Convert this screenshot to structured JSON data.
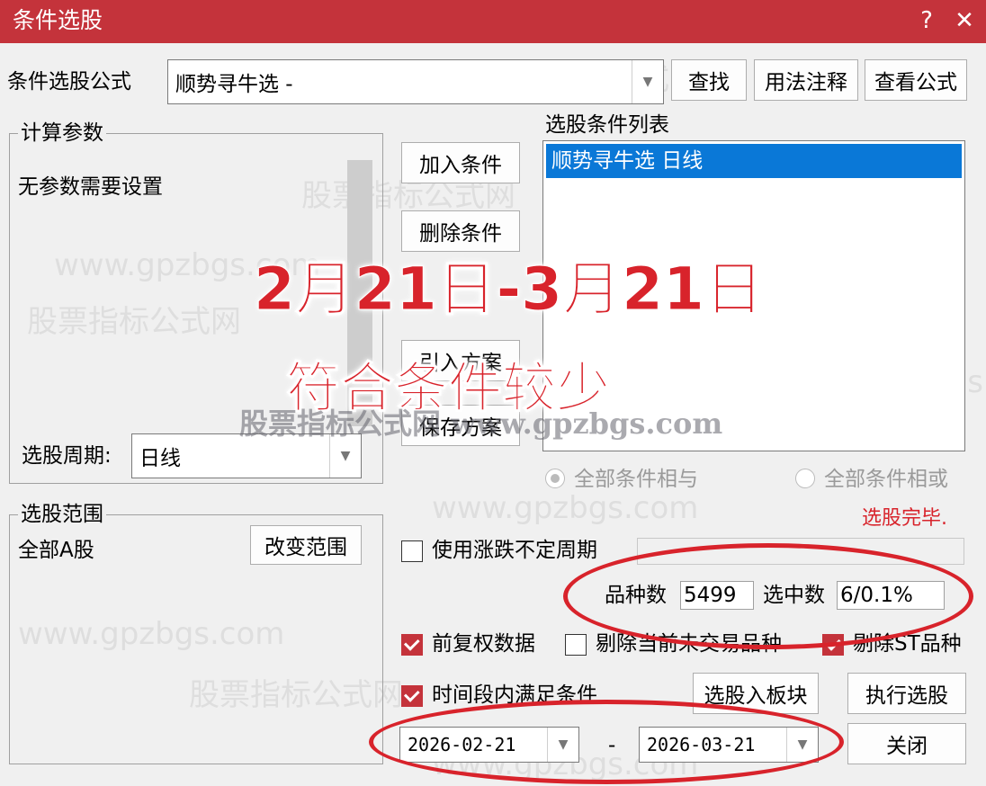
{
  "window": {
    "title": "条件选股",
    "help_symbol": "?",
    "close_symbol": "✕"
  },
  "formula": {
    "label": "条件选股公式",
    "value": "顺势寻牛选  -",
    "find_button": "查找",
    "usage_button": "用法注释",
    "view_button": "查看公式"
  },
  "params": {
    "legend": "计算参数",
    "message": "无参数需要设置",
    "period_label": "选股周期:",
    "period_value": "日线"
  },
  "buttons": {
    "add_condition": "加入条件",
    "delete_condition": "删除条件",
    "import_plan": "引入方案",
    "save_plan": "保存方案",
    "change_range": "改变范围",
    "to_block": "选股入板块",
    "execute": "执行选股",
    "close": "关闭"
  },
  "conditions": {
    "legend": "选股条件列表",
    "items": [
      "顺势寻牛选  日线"
    ],
    "radio_and": "全部条件相与",
    "radio_or": "全部条件相或",
    "status": "选股完毕."
  },
  "range": {
    "legend": "选股范围",
    "value": "全部A股"
  },
  "options": {
    "use_unfixed_period": "使用涨跌不定周期",
    "stock_count_label": "品种数",
    "stock_count_value": "5499",
    "selected_label": "选中数",
    "selected_value": "6/0.1%",
    "forward_adjusted": "前复权数据",
    "exclude_untraded": "剔除当前未交易品种",
    "exclude_st": "剔除ST品种",
    "period_satisfy": "时间段内满足条件"
  },
  "dates": {
    "start": "2026-02-21",
    "separator": "-",
    "end": "2026-03-21"
  },
  "overlay": {
    "date_range": "2月21日-3月21日",
    "note": "符合条件较少",
    "watermark_center": "股票指标公式网 www.gpzbgs.com"
  },
  "watermark": {
    "domain": "www.gpzbgs.com",
    "site": "股票指标公式网"
  },
  "colors": {
    "title_bar": "#c4333b",
    "selection": "#0a78d7",
    "annotation_red": "#d8232b",
    "status_red": "#d8232b"
  }
}
